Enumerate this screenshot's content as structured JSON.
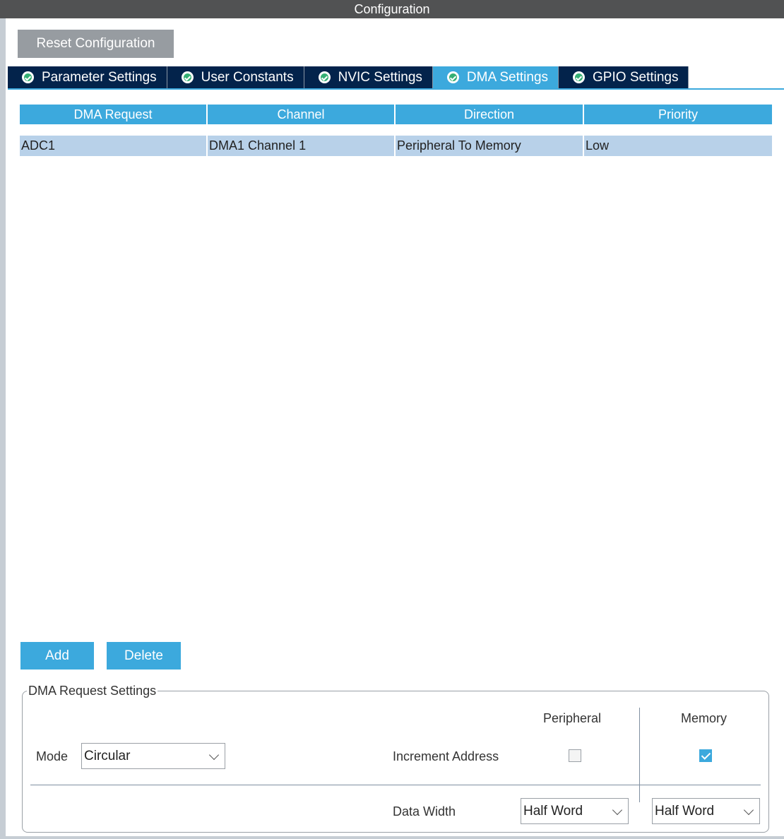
{
  "window": {
    "title": "Configuration"
  },
  "toolbar": {
    "reset_label": "Reset Configuration"
  },
  "tabs": [
    {
      "label": "Parameter Settings",
      "icon": "check-circle-icon",
      "active": false
    },
    {
      "label": "User Constants",
      "icon": "check-circle-icon",
      "active": false
    },
    {
      "label": "NVIC Settings",
      "icon": "check-circle-icon",
      "active": false
    },
    {
      "label": "DMA Settings",
      "icon": "check-circle-icon",
      "active": true
    },
    {
      "label": "GPIO Settings",
      "icon": "check-circle-icon",
      "active": false
    }
  ],
  "table": {
    "columns": [
      "DMA Request",
      "Channel",
      "Direction",
      "Priority"
    ],
    "rows": [
      [
        "ADC1",
        "DMA1 Channel 1",
        "Peripheral To Memory",
        "Low"
      ]
    ]
  },
  "actions": {
    "add_label": "Add",
    "delete_label": "Delete"
  },
  "settings": {
    "group_title": "DMA Request Settings",
    "mode_label": "Mode",
    "mode_value": "Circular",
    "peripheral_header": "Peripheral",
    "memory_header": "Memory",
    "increment_label": "Increment Address",
    "increment_peripheral": false,
    "increment_memory": true,
    "data_width_label": "Data Width",
    "peripheral_width": "Half Word",
    "memory_width": "Half Word"
  },
  "colors": {
    "accent": "#3ca9dd",
    "tab_dark": "#03234b",
    "row_selected": "#b8d1e9",
    "titlebar": "#515253",
    "check_green": "#35b074"
  }
}
